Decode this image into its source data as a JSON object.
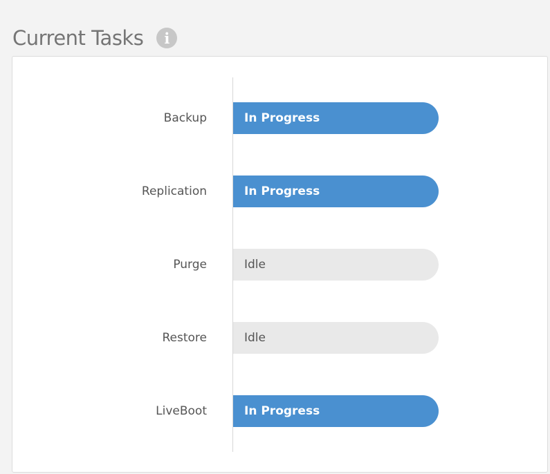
{
  "panel": {
    "title": "Current Tasks",
    "info_icon": "info-icon"
  },
  "colors": {
    "in_progress": "#4a90d0",
    "idle": "#e9e9e9",
    "title": "#757575",
    "label": "#555555"
  },
  "tasks": [
    {
      "label": "Backup",
      "status": "In Progress",
      "state": "active"
    },
    {
      "label": "Replication",
      "status": "In Progress",
      "state": "active"
    },
    {
      "label": "Purge",
      "status": "Idle",
      "state": "idle"
    },
    {
      "label": "Restore",
      "status": "Idle",
      "state": "idle"
    },
    {
      "label": "LiveBoot",
      "status": "In Progress",
      "state": "active"
    }
  ]
}
